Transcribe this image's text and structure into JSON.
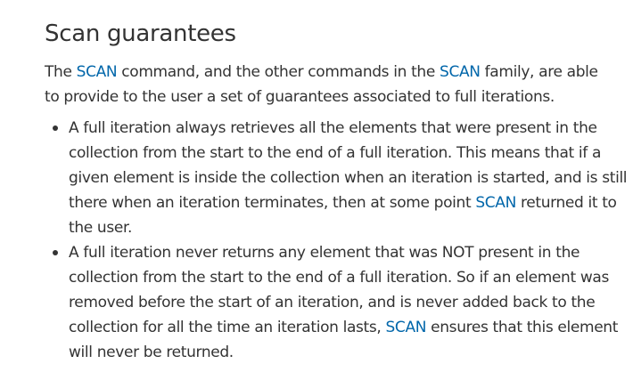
{
  "section": {
    "heading": "Scan guarantees"
  },
  "intro": {
    "t1": "The ",
    "link1": "SCAN",
    "t2": " command, and the other commands in the ",
    "link2": "SCAN",
    "t3": " family, are able to provide to the user a set of guarantees associated to full iterations."
  },
  "bullets": [
    {
      "t1": "A full iteration always retrieves all the elements that were present in the collection from the start to the end of a full iteration. This means that if a given element is inside the collection when an iteration is started, and is still there when an iteration terminates, then at some point ",
      "link": "SCAN",
      "t2": " returned it to the user."
    },
    {
      "t1": "A full iteration never returns any element that was NOT present in the collection from the start to the end of a full iteration. So if an element was removed before the start of an iteration, and is never added back to the collection for all the time an iteration lasts, ",
      "link": "SCAN",
      "t2": " ensures that this element will never be returned."
    }
  ],
  "colors": {
    "text": "#333333",
    "link": "#0066aa",
    "background": "#ffffff"
  }
}
